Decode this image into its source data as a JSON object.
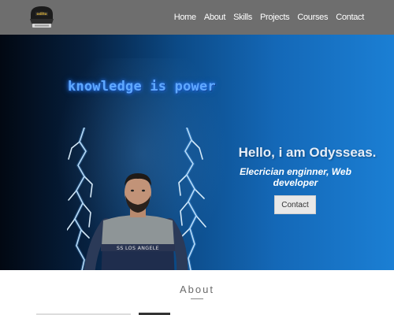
{
  "navbar": {
    "logo_icon": "cap-logo-icon",
    "links": [
      "Home",
      "About",
      "Skills",
      "Projects",
      "Courses",
      "Contact"
    ]
  },
  "hero": {
    "slogan": "knowledge is power",
    "title": "Hello, i am Odysseas.",
    "subtitle": "Elecrician enginner, Web developer",
    "contact_button": "Contact",
    "colors": {
      "gradient_start": "#020812",
      "gradient_end": "#1b7fd4",
      "slogan": "#5fa8ff"
    }
  },
  "about": {
    "title": "About"
  }
}
